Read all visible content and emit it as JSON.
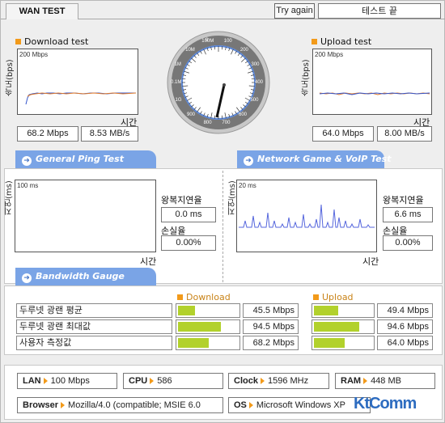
{
  "header": {
    "tab_title": "WAN TEST",
    "try_again": "Try again",
    "status": "테스트 끝"
  },
  "download": {
    "title": "Download test",
    "axis_label": "속도(bps)",
    "scale": "200 Mbps",
    "time_label": "시간",
    "mbps": "68.2 Mbps",
    "mbs": "8.53 MB/s"
  },
  "upload": {
    "title": "Upload test",
    "axis_label": "속도(bps)",
    "scale": "200 Mbps",
    "time_label": "시간",
    "mbps": "64.0 Mbps",
    "mbs": "8.00 MB/s"
  },
  "gauge": {
    "ticks": [
      "0",
      "100",
      "200",
      "300",
      "400",
      "500",
      "600",
      "700",
      "800",
      "900",
      "1G",
      "0.1M",
      "1M",
      "10M",
      "100M"
    ],
    "needle_value": "68.2 Mbps"
  },
  "ping": {
    "section": "General Ping Test",
    "axis_label": "지연(ms)",
    "scale": "100 ms",
    "time_label": "시간",
    "latency_label": "왕복지연율",
    "latency": "0.0 ms",
    "loss_label": "손실율",
    "loss": "0.00%"
  },
  "game": {
    "section": "Network Game & VoIP Test",
    "axis_label": "지연(ms)",
    "scale": "20 ms",
    "time_label": "시간",
    "latency_label": "왕복지연율",
    "latency": "6.6 ms",
    "loss_label": "손실율",
    "loss": "0.00%"
  },
  "bandwidth": {
    "section": "Bandwidth Gauge",
    "download_header": "Download",
    "upload_header": "Upload",
    "rows": [
      {
        "label": "두루넷 광랜 평균",
        "download": "45.5 Mbps",
        "download_pct": 0.28,
        "upload": "49.4 Mbps",
        "upload_pct": 0.41
      },
      {
        "label": "두루넷 광랜 최대값",
        "download": "94.5 Mbps",
        "download_pct": 0.72,
        "upload": "94.6 Mbps",
        "upload_pct": 0.78
      },
      {
        "label": "사용자 측정값",
        "download": "68.2 Mbps",
        "download_pct": 0.52,
        "upload": "64.0 Mbps",
        "upload_pct": 0.53
      }
    ]
  },
  "system": {
    "lan_label": "LAN",
    "lan": "100 Mbps",
    "cpu_label": "CPU",
    "cpu": "586",
    "clock_label": "Clock",
    "clock": "1596 MHz",
    "ram_label": "RAM",
    "ram": "448 MB",
    "browser_label": "Browser",
    "browser": "Mozilla/4.0 (compatible; MSIE 6.0",
    "os_label": "OS",
    "os": "Microsoft Windows XP",
    "logo": "KtComm"
  },
  "colors": {
    "accent": "#7aa4e6",
    "bar": "#b2d12c",
    "marker": "#f29a1a",
    "line": "#3355cc"
  }
}
